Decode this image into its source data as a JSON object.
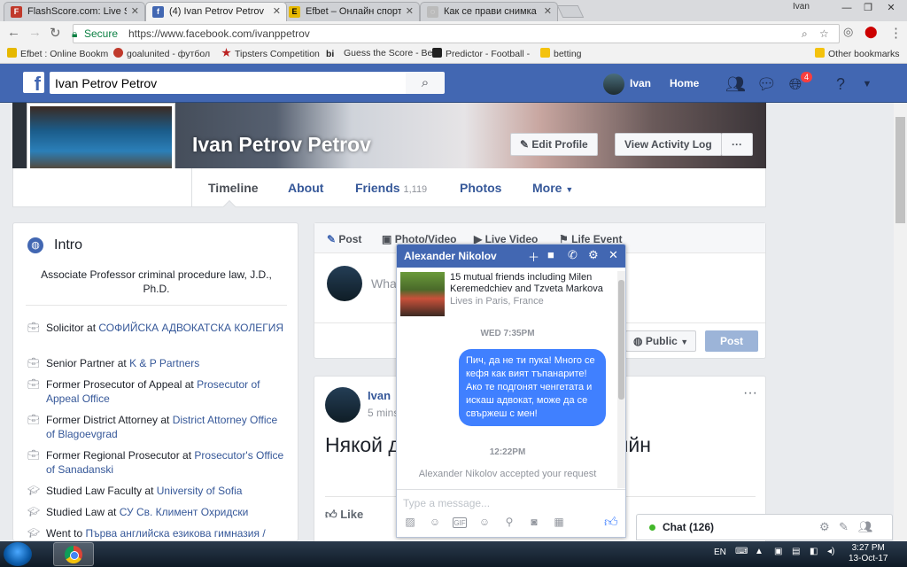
{
  "browser": {
    "tabs": [
      {
        "title": "FlashScore.com: Live Soc",
        "icon": "flashscore-icon",
        "color": "#c0392b"
      },
      {
        "title": "(4) Ivan Petrov Petrov",
        "icon": "facebook-icon",
        "color": "#4267b2"
      },
      {
        "title": "Efbet – Онлайн спортни",
        "icon": "efbet-icon",
        "color": "#e6b800"
      },
      {
        "title": "Как се прави снимка на",
        "icon": "page-icon",
        "color": "#888888"
      }
    ],
    "user": "Ivan",
    "secure_label": "Secure",
    "url": "https://www.facebook.com/ivanppetrov",
    "bookmarks": [
      {
        "label": "Efbet : Online Bookm"
      },
      {
        "label": "goalunited - футбол"
      },
      {
        "label": "Tipsters Competition"
      },
      {
        "label": "Guess the Score - Be"
      },
      {
        "label": "Predictor - Football -"
      },
      {
        "label": "betting"
      }
    ],
    "other_bookmarks": "Other bookmarks"
  },
  "fb": {
    "search_value": "Ivan Petrov Petrov",
    "nav_user": "Ivan",
    "nav_home": "Home",
    "notif_count": "4"
  },
  "profile": {
    "name": "Ivan Petrov Petrov",
    "edit_profile": "Edit Profile",
    "view_activity": "View Activity Log",
    "more_dots": "···",
    "tabs": [
      "Timeline",
      "About",
      "Friends",
      "Photos",
      "More"
    ],
    "friends_count": "1,119"
  },
  "intro": {
    "title": "Intro",
    "bio": "Associate Professor criminal procedure law, J.D., Ph.D.",
    "items": [
      {
        "pre": "Solicitor at ",
        "link": "СОФИЙСКА АДВОКАТСКА КОЛЕГИЯ"
      },
      {
        "pre": "Senior Partner at ",
        "link": "K & P Partners"
      },
      {
        "pre": "Former Prosecutor of Appeal at ",
        "link": "Prosecutor of Appeal Office"
      },
      {
        "pre": "Former District Attorney at ",
        "link": "District Attorney Office of Blagoevgrad"
      },
      {
        "pre": "Former Regional Prosecutor at ",
        "link": "Prosecutor's Office of Sanadanski"
      },
      {
        "pre": "Studied Law Faculty at ",
        "link": "University of Sofia"
      },
      {
        "pre": "Studied Law at ",
        "link": "СУ Св. Климент Охридски"
      },
      {
        "pre": "Went to ",
        "link": "Първа английска езикова гимназия /"
      }
    ]
  },
  "composer": {
    "tabs": [
      "Post",
      "Photo/Video",
      "Live Video",
      "Life Event"
    ],
    "placeholder": "Wha",
    "public": "Public",
    "post": "Post"
  },
  "post": {
    "author": "Ivan",
    "time": "5 mins",
    "text": "Някой д                            ви скрийн",
    "like": "Like"
  },
  "chat": {
    "name": "Alexander Nikolov",
    "mutual": "15 mutual friends including Milen Keremedchiev and Tzveta Markova",
    "lives": "Lives in Paris, France",
    "ts1": "WED 7:35PM",
    "message": "Пич, да не ти пука! Много се кефя как вият тъпанарите! Ако те подгонят ченгетата и искаш адвокат, може да се свържеш с мен!",
    "ts2": "12:22PM",
    "system": "Alexander Nikolov accepted your request",
    "input_placeholder": "Type a message..."
  },
  "chatbar": {
    "label": "Chat (126)"
  },
  "taskbar": {
    "lang": "EN",
    "time": "3:27 PM",
    "date": "13-Oct-17"
  }
}
